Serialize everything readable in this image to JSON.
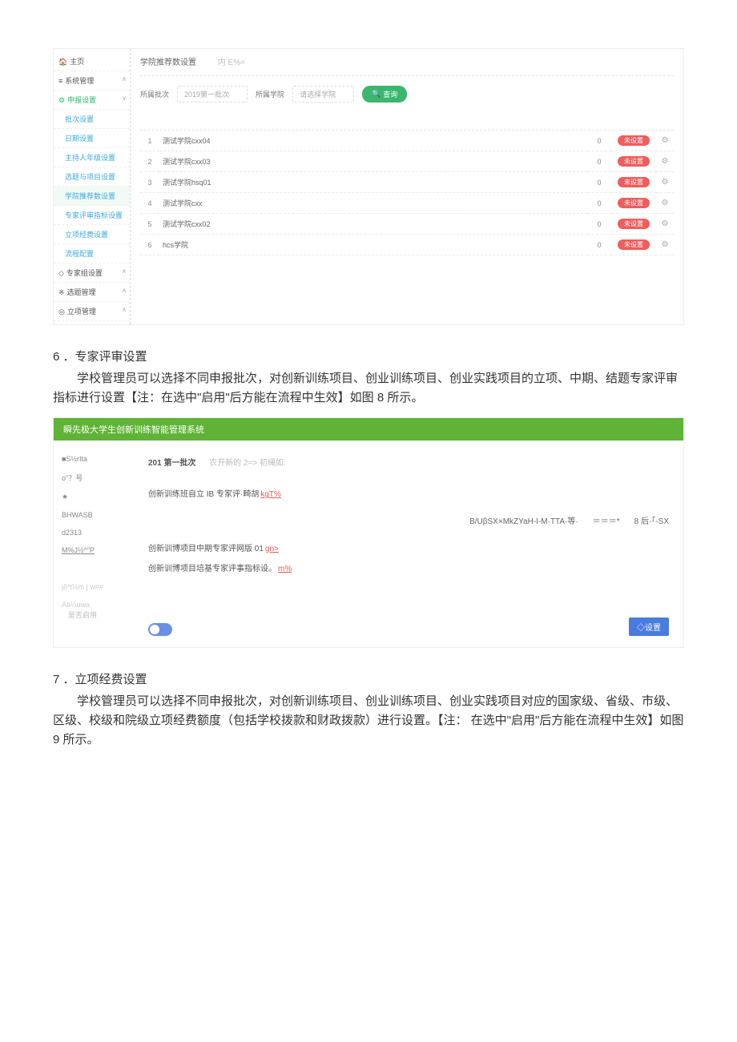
{
  "shot1": {
    "sidebar": [
      {
        "icon": "🏠",
        "label": "主页",
        "cls": ""
      },
      {
        "icon": "≡",
        "label": "系统管理",
        "cls": "",
        "caret": "∧"
      },
      {
        "icon": "⚙",
        "label": "申报设置",
        "cls": "active",
        "caret": "∨"
      },
      {
        "icon": "",
        "label": "批次设置",
        "cls": "sub"
      },
      {
        "icon": "",
        "label": "日期设置",
        "cls": "sub"
      },
      {
        "icon": "",
        "label": "主持人年级设置",
        "cls": "sub"
      },
      {
        "icon": "",
        "label": "选题与项目设置",
        "cls": "sub"
      },
      {
        "icon": "",
        "label": "学院推荐数设置",
        "cls": "sub",
        "sel": true
      },
      {
        "icon": "",
        "label": "专家评审指标设置",
        "cls": "sub"
      },
      {
        "icon": "",
        "label": "立项经费设置",
        "cls": "sub"
      },
      {
        "icon": "",
        "label": "流程配置",
        "cls": "sub"
      },
      {
        "icon": "◇",
        "label": "专家组设置",
        "cls": "",
        "caret": "∧"
      },
      {
        "icon": "※",
        "label": "选题管理",
        "cls": "",
        "caret": "∧"
      },
      {
        "icon": "◎",
        "label": "立项管理",
        "cls": "",
        "caret": "∧"
      }
    ],
    "crumbTitle": "学院推荐数设置",
    "crumbAlt": "内 E%=",
    "filterLabel1": "所属批次",
    "filterSel1": "2019第一批次",
    "filterLabel2": "所属学院",
    "filterSel2": "请选择学院",
    "queryBtn": "查询",
    "rows": [
      {
        "n": "1",
        "name": "测试学院cxx04",
        "v": "0",
        "tag": "未设置"
      },
      {
        "n": "2",
        "name": "测试学院cxx03",
        "v": "0",
        "tag": "未设置"
      },
      {
        "n": "3",
        "name": "测试学院hsq01",
        "v": "0",
        "tag": "未设置"
      },
      {
        "n": "4",
        "name": "测试学院cxx",
        "v": "0",
        "tag": "未设置"
      },
      {
        "n": "5",
        "name": "测试学院cxx02",
        "v": "0",
        "tag": "未设置"
      },
      {
        "n": "6",
        "name": "hcs学院",
        "v": "0",
        "tag": "未设置"
      }
    ]
  },
  "section6": {
    "heading": "6 ．专家评审设置",
    "para": "学校管理员可以选择不同申报批次，对创新训练项目、创业训练项目、创业实践项目的立项、中期、结题专家评审指标进行设置【注：在选中\"启用\"后方能在流程中生效】如图 8 所示。"
  },
  "shot2": {
    "bar": "瞬先极大学生创新训练智能管理系统",
    "sb": {
      "a": "■S½rIta",
      "b": "o\"？号",
      "c": "★",
      "d": "BHWASB",
      "e": "d2313",
      "f": "M%J½^\"P",
      "g1": "jδ*t½m | w##",
      "g2": "Aa½uwa"
    },
    "line1a": "201 第一批次",
    "line1b": "农开新的 2=> 初绳如:",
    "lineLink1_a": "创新训练班自立 IB 专家评·畸胡",
    "lineLink1_b": "kgT%",
    "midA": "B/UβSX×MkZYaH-I-M·TTA·等·",
    "midB": "＝＝＝*",
    "midC": "8 后·「-SX",
    "lineLink2_a": "创新训博项目中期专家评网版 01",
    "lineLink2_b": "gn>",
    "lineLink3_a": "创新训博项目培基专家评事指标设。",
    "lineLink3_b": "m%",
    "toggleLabel": "是否启用",
    "blueBtn": "◇设置"
  },
  "section7": {
    "heading": "7 ．立项经费设置",
    "para": "学校管理员可以选择不同申报批次，对创新训练项目、创业训练项目、创业实践项目对应的国家级、省级、市级、区级、校级和院级立项经费额度（包括学校拨款和财政拨款）进行设置。【注： 在选中\"启用\"后方能在流程中生效】如图 9 所示。"
  }
}
